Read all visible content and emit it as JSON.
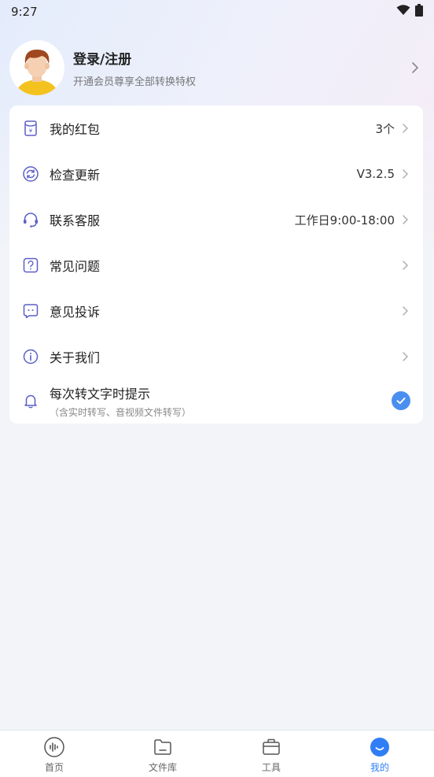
{
  "status_bar": {
    "time": "9:27"
  },
  "profile": {
    "title": "登录/注册",
    "subtitle": "开通会员尊享全部转换特权"
  },
  "menu": {
    "items": [
      {
        "label": "我的红包",
        "value": "3个",
        "icon": "red-packet-icon"
      },
      {
        "label": "检查更新",
        "value": "V3.2.5",
        "icon": "refresh-icon"
      },
      {
        "label": "联系客服",
        "value": "工作日9:00-18:00",
        "icon": "headset-icon"
      },
      {
        "label": "常见问题",
        "value": "",
        "icon": "question-icon"
      },
      {
        "label": "意见投诉",
        "value": "",
        "icon": "feedback-icon"
      },
      {
        "label": "关于我们",
        "value": "",
        "icon": "info-icon"
      }
    ],
    "tip": {
      "title": "每次转文字时提示",
      "subtitle": "（含实时转写、音视频文件转写）",
      "checked": true
    }
  },
  "tabbar": {
    "tabs": [
      {
        "label": "首页",
        "icon": "voice-icon"
      },
      {
        "label": "文件库",
        "icon": "folder-icon"
      },
      {
        "label": "工具",
        "icon": "toolbox-icon"
      },
      {
        "label": "我的",
        "icon": "profile-icon",
        "active": true
      }
    ]
  },
  "colors": {
    "accent": "#2f7ef5",
    "icon": "#5b5fc7",
    "check": "#4a8ff0"
  }
}
